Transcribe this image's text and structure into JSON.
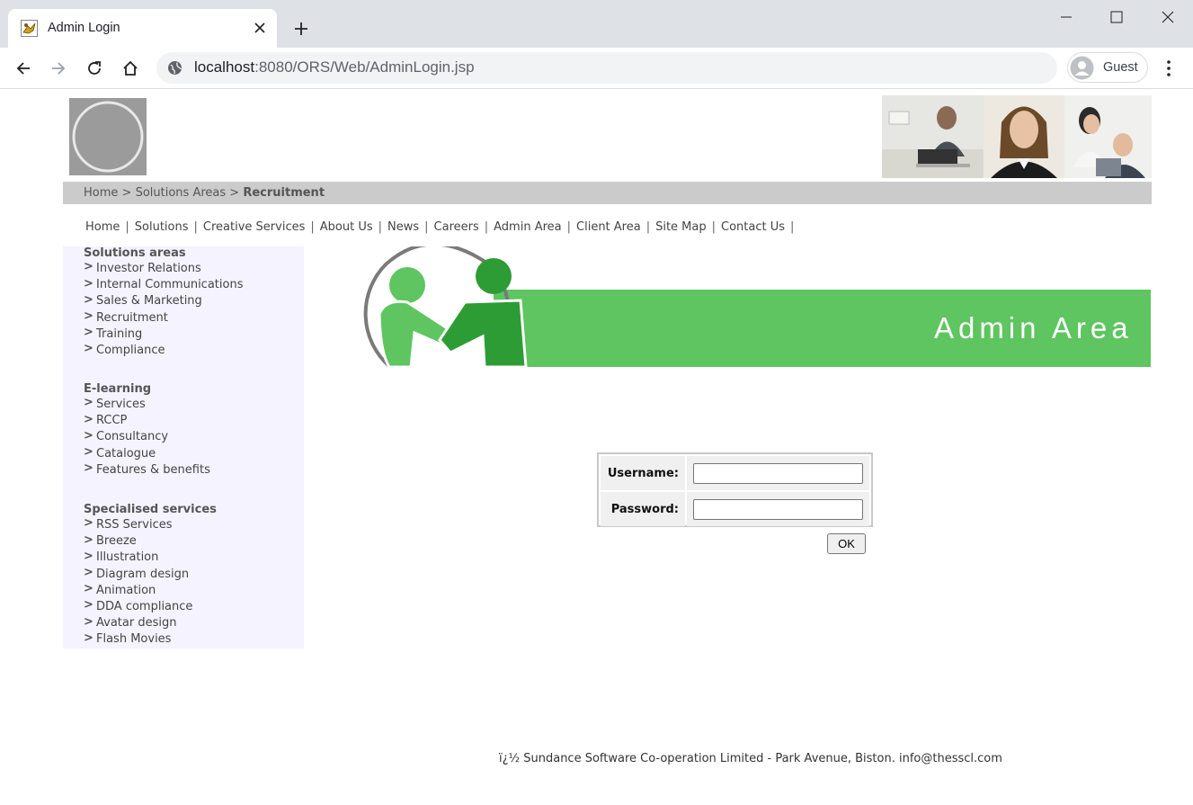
{
  "browser": {
    "tab_title": "Admin Login",
    "url_host": "localhost",
    "url_path": ":8080/ORS/Web/AdminLogin.jsp",
    "profile_label": "Guest"
  },
  "header": {
    "breadcrumb": {
      "home": "Home",
      "sep": ">",
      "section": "Solutions Areas",
      "current": "Recruitment"
    }
  },
  "topnav": {
    "items": [
      "Home",
      "Solutions",
      "Creative Services",
      "About Us",
      "News",
      "Careers",
      "Admin Area",
      "Client Area",
      "Site Map",
      "Contact Us"
    ],
    "separator": "|"
  },
  "sidebar": {
    "groups": [
      {
        "heading": "Solutions areas",
        "items": [
          "Investor Relations",
          "Internal Communications",
          "Sales & Marketing",
          "Recruitment",
          "Training",
          "Compliance"
        ]
      },
      {
        "heading": "E-learning",
        "items": [
          "Services",
          "RCCP",
          "Consultancy",
          "Catalogue",
          "Features & benefits"
        ]
      },
      {
        "heading": "Specialised services",
        "items": [
          "RSS Services",
          "Breeze",
          "Illustration",
          "Diagram design",
          "Animation",
          "DDA compliance",
          "Avatar design",
          "Flash Movies"
        ]
      }
    ]
  },
  "banner": {
    "title": "Admin Area"
  },
  "login": {
    "username_label": "Username:",
    "password_label": "Password:",
    "username_value": "",
    "password_value": "",
    "ok_label": "OK"
  },
  "footer": {
    "text": "ï¿½ Sundance Software Co-operation Limited - Park Avenue, Biston. info@thesscl.com"
  },
  "colors": {
    "banner_green": "#5ec560",
    "breadcrumb_bg": "#cbcbcb",
    "sidebar_bg": "#f5f3ff"
  }
}
